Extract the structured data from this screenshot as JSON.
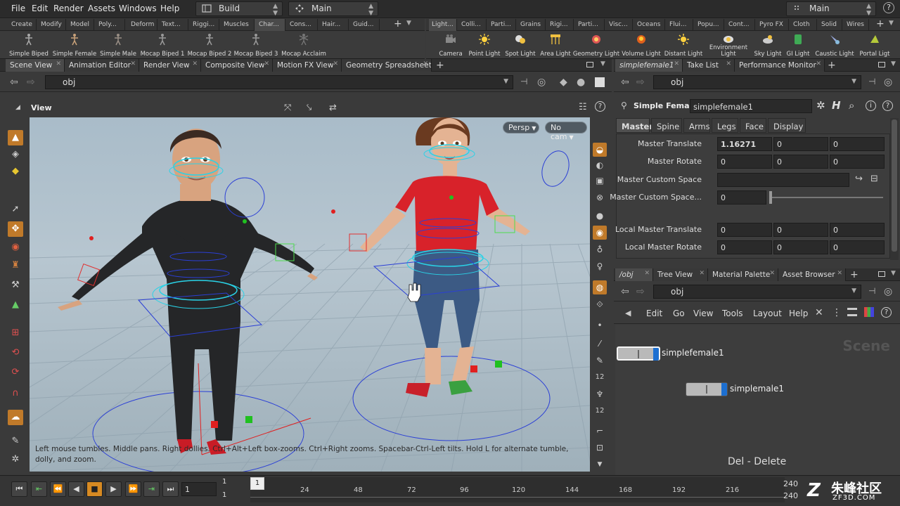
{
  "menubar": {
    "items": [
      "File",
      "Edit",
      "Render",
      "Assets",
      "Windows",
      "Help"
    ],
    "desktop_combo": "Build",
    "main_combo": "Main",
    "right_combo": "Main"
  },
  "shelf_left": {
    "tabs": [
      "Create",
      "Modify",
      "Model",
      "Poly...",
      "Deform",
      "Text...",
      "Riggi...",
      "Muscles",
      "Char...",
      "Cons...",
      "Hair...",
      "Guid..."
    ],
    "active_tab": "Char...",
    "tools": [
      {
        "label": "Simple Biped",
        "icon": "biped-icon"
      },
      {
        "label": "Simple Female",
        "icon": "female-icon"
      },
      {
        "label": "Simple Male",
        "icon": "male-icon"
      },
      {
        "label": "Mocap Biped 1",
        "icon": "mocap-biped-icon"
      },
      {
        "label": "Mocap Biped 2",
        "icon": "mocap-biped-icon"
      },
      {
        "label": "Mocap Biped 3",
        "icon": "mocap-biped-icon"
      },
      {
        "label": "Mocap Acclaim",
        "icon": "mocap-acclaim-icon"
      }
    ]
  },
  "shelf_right": {
    "tabs": [
      "Light...",
      "Colli...",
      "Parti...",
      "Grains",
      "Rigi...",
      "Parti...",
      "Visc...",
      "Oceans",
      "Flui...",
      "Popu...",
      "Cont...",
      "Pyro FX",
      "Cloth",
      "Solid",
      "Wires"
    ],
    "active_tab": "Light...",
    "tools": [
      {
        "label": "Camera",
        "icon": "camera-icon"
      },
      {
        "label": "Point Light",
        "icon": "point-light-icon"
      },
      {
        "label": "Spot Light",
        "icon": "spot-light-icon"
      },
      {
        "label": "Area Light",
        "icon": "area-light-icon"
      },
      {
        "label": "Geometry Light",
        "icon": "geometry-light-icon"
      },
      {
        "label": "Volume Light",
        "icon": "volume-light-icon"
      },
      {
        "label": "Distant Light",
        "icon": "distant-light-icon"
      },
      {
        "label": "Environment Light",
        "icon": "environment-light-icon"
      },
      {
        "label": "Sky Light",
        "icon": "sky-light-icon"
      },
      {
        "label": "GI Light",
        "icon": "gi-light-icon"
      },
      {
        "label": "Caustic Light",
        "icon": "caustic-light-icon"
      },
      {
        "label": "Portal Ligt",
        "icon": "portal-light-icon"
      }
    ]
  },
  "left_pane": {
    "tabs": [
      "Scene View",
      "Animation Editor",
      "Render View",
      "Composite View",
      "Motion FX View",
      "Geometry Spreadsheet"
    ],
    "active_tab": "Scene View",
    "path": "obj",
    "view_label": "View",
    "persp_button": "Persp",
    "cam_button": "No cam",
    "hint": "Left mouse tumbles. Middle pans. Right dollies. Ctrl+Alt+Left box-zooms. Ctrl+Right zooms. Spacebar-Ctrl-Left tilts. Hold L for alternate tumble, dolly, and zoom."
  },
  "param_pane": {
    "tabs": [
      "simplefemale1",
      "Take List",
      "Performance Monitor"
    ],
    "active_tab": "simplefemale1",
    "path": "obj",
    "node_type": "Simple Female",
    "node_name": "simplefemale1",
    "param_tabs": [
      "Master",
      "Spine",
      "Arms",
      "Legs",
      "Face",
      "Display"
    ],
    "active_param_tab": "Master",
    "rows": [
      {
        "label": "Master Translate",
        "values": [
          "1.16271",
          "0",
          "0"
        ]
      },
      {
        "label": "Master Rotate",
        "values": [
          "0",
          "0",
          "0"
        ]
      },
      {
        "label": "Master Custom Space",
        "values": [
          ""
        ]
      },
      {
        "label": "Master Custom Space...",
        "values": [
          "0"
        ]
      },
      {
        "label": "Local Master Translate",
        "values": [
          "0",
          "0",
          "0"
        ]
      },
      {
        "label": "Local Master Rotate",
        "values": [
          "0",
          "0",
          "0"
        ]
      }
    ]
  },
  "network_pane": {
    "tabs": [
      "/obj",
      "Tree View",
      "Material Palette",
      "Asset Browser"
    ],
    "active_tab": "/obj",
    "path": "obj",
    "menu": [
      "Edit",
      "Go",
      "View",
      "Tools",
      "Layout",
      "Help"
    ],
    "watermark": "Scene",
    "nodes": [
      {
        "name": "simplefemale1",
        "selected": true
      },
      {
        "name": "simplemale1",
        "selected": false
      }
    ],
    "shortcut_hint": "Del - Delete"
  },
  "timeline": {
    "current_frame": "1",
    "start": "1",
    "start2": "1",
    "ticks": [
      "24",
      "48",
      "72",
      "96",
      "120",
      "144",
      "168",
      "192",
      "216"
    ],
    "end": "240",
    "end2": "240",
    "frame_marker": "1"
  },
  "watermark": {
    "brand": "朱峰社区",
    "url": "ZF3D.COM"
  },
  "colors": {
    "accent": "#d78a22",
    "selection_blue": "#1c6fd1",
    "female_shirt": "#d8222a",
    "rig_blue": "#2b3fd6"
  }
}
